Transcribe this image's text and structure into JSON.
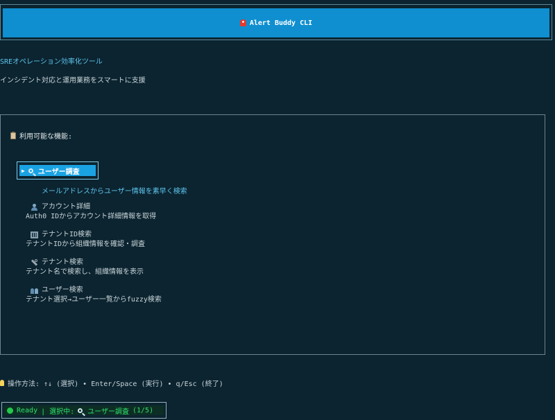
{
  "header": {
    "title": "Alert Buddy CLI",
    "icon": "siren-icon",
    "bar_color": "#0f8fd0"
  },
  "app": {
    "subtitle": "SREオペレーション効率化ツール",
    "description": "インシデント対応と運用業務をスマートに支援"
  },
  "menu": {
    "heading": "利用可能な機能:",
    "heading_icon": "clipboard-icon",
    "selected": {
      "arrow": "▶",
      "icon": "magnifier-icon",
      "label": "ユーザー調査",
      "description": "メールアドレスからユーザー情報を素早く検索"
    },
    "items": [
      {
        "label": "アカウント詳細",
        "description": "Auth0 IDからアカウント詳細情報を取得",
        "icon": "person-icon"
      },
      {
        "label": "テナントID検索",
        "description": "テナントIDから組織情報を確認・調査",
        "icon": "building-icon"
      },
      {
        "label": "テナント検索",
        "description": "テナント名で検索し、組織情報を表示",
        "icon": "wrench-icon"
      },
      {
        "label": "ユーザー検索",
        "description": "テナント選択→ユーザー一覧からfuzzy検索",
        "icon": "people-icon"
      }
    ]
  },
  "instructions": {
    "icon": "lightbulb-icon",
    "text": "操作方法: ↑↓ (選択) • Enter/Space (実行) • q/Esc (終了)"
  },
  "status": {
    "state": "Ready",
    "prefix": "| 選択中:",
    "selected_label": "ユーザー調査",
    "position": "(1/5)",
    "color": "#2fe06c"
  }
}
